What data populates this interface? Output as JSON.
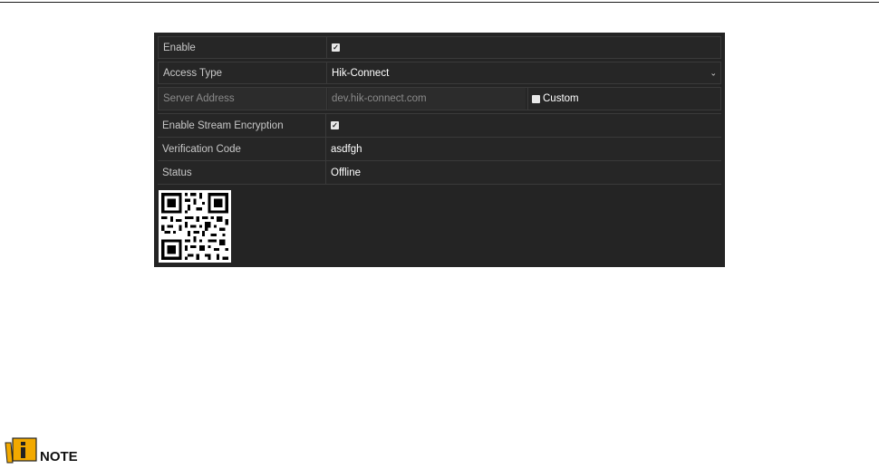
{
  "form": {
    "enable": {
      "label": "Enable",
      "checked": true
    },
    "access_type": {
      "label": "Access Type",
      "value": "Hik-Connect"
    },
    "server_address": {
      "label": "Server Address",
      "value": "dev.hik-connect.com",
      "custom_label": "Custom",
      "custom_checked": false
    },
    "stream_encryption": {
      "label": "Enable Stream Encryption",
      "checked": true
    },
    "verification_code": {
      "label": "Verification Code",
      "value": "asdfgh"
    },
    "status": {
      "label": "Status",
      "value": "Offline"
    }
  },
  "note": {
    "label": "NOTE"
  },
  "icons": {
    "qr": "qr-code-icon",
    "note": "note-book-icon",
    "check": "check-icon",
    "caret": "chevron-down-icon"
  },
  "colors": {
    "panel_bg": "#242424",
    "border": "#3a3a3a",
    "label_text": "#c8c8c8",
    "value_text": "#ffffff",
    "note_icon": "#f2a900"
  }
}
